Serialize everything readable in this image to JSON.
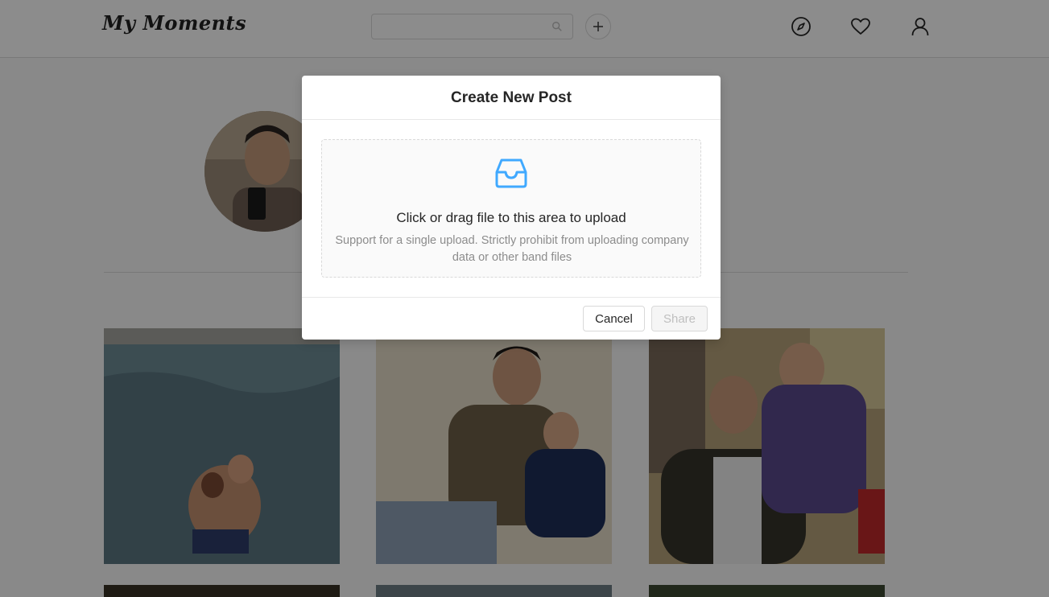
{
  "header": {
    "logo": "My Moments",
    "search_placeholder": "",
    "icons": [
      "search-icon",
      "plus-icon",
      "compass-icon",
      "heart-icon",
      "user-icon"
    ]
  },
  "profile": {
    "avatar": "profile-avatar"
  },
  "modal": {
    "title": "Create New Post",
    "upload_text": "Click or drag file to this area to upload",
    "upload_hint": "Support for a single upload. Strictly prohibit from uploading company data or other band files",
    "cancel_label": "Cancel",
    "share_label": "Share",
    "accent_color": "#40a9ff"
  }
}
